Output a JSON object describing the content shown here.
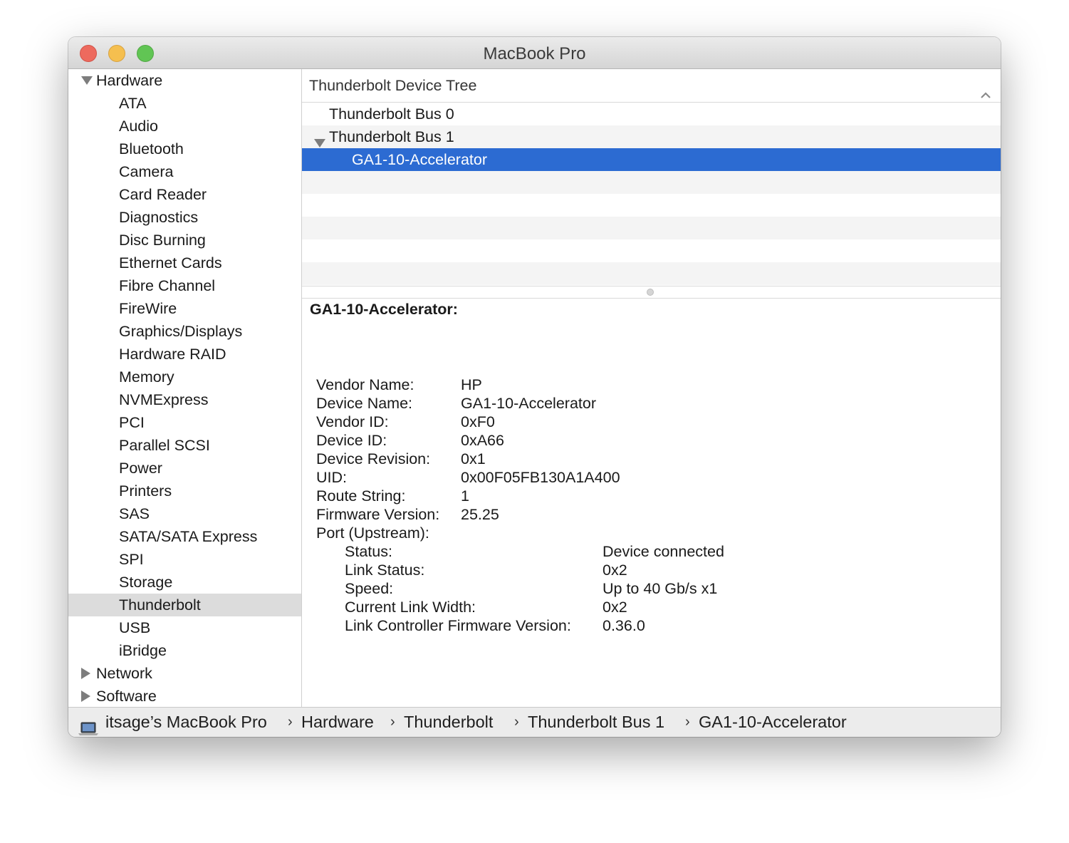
{
  "window": {
    "title": "MacBook Pro",
    "controls": {
      "close": "close",
      "minimize": "minimize",
      "zoom": "zoom"
    }
  },
  "sidebar": {
    "groups": [
      {
        "label": "Hardware",
        "expanded": true,
        "children": [
          "ATA",
          "Audio",
          "Bluetooth",
          "Camera",
          "Card Reader",
          "Diagnostics",
          "Disc Burning",
          "Ethernet Cards",
          "Fibre Channel",
          "FireWire",
          "Graphics/Displays",
          "Hardware RAID",
          "Memory",
          "NVMExpress",
          "PCI",
          "Parallel SCSI",
          "Power",
          "Printers",
          "SAS",
          "SATA/SATA Express",
          "SPI",
          "Storage",
          "Thunderbolt",
          "USB",
          "iBridge"
        ]
      },
      {
        "label": "Network",
        "expanded": false
      },
      {
        "label": "Software",
        "expanded": false
      }
    ],
    "selected": "Thunderbolt"
  },
  "tree": {
    "header": "Thunderbolt Device Tree",
    "sort_icon": "chevron-up-icon",
    "rows": [
      {
        "label": "Thunderbolt Bus 0",
        "level": 0,
        "expandable": false
      },
      {
        "label": "Thunderbolt Bus 1",
        "level": 0,
        "expandable": true,
        "expanded": true
      },
      {
        "label": "GA1-10-Accelerator",
        "level": 1,
        "selected": true
      }
    ]
  },
  "detail": {
    "title": "GA1-10-Accelerator:",
    "fields": [
      {
        "key": "Vendor Name:",
        "value": "HP"
      },
      {
        "key": "Device Name:",
        "value": "GA1-10-Accelerator"
      },
      {
        "key": "Vendor ID:",
        "value": "0xF0"
      },
      {
        "key": "Device ID:",
        "value": "0xA66"
      },
      {
        "key": "Device Revision:",
        "value": "0x1"
      },
      {
        "key": "UID:",
        "value": "0x00F05FB130A1A400"
      },
      {
        "key": "Route String:",
        "value": "1"
      },
      {
        "key": "Firmware Version:",
        "value": "25.25"
      },
      {
        "key": "Port (Upstream):",
        "value": ""
      }
    ],
    "port_fields": [
      {
        "key": "Status:",
        "value": "Device connected"
      },
      {
        "key": "Link Status:",
        "value": "0x2"
      },
      {
        "key": "Speed:",
        "value": "Up to 40 Gb/s x1"
      },
      {
        "key": "Current Link Width:",
        "value": "0x2"
      },
      {
        "key": "Link Controller Firmware Version:",
        "value": "0.36.0"
      }
    ]
  },
  "statusbar": {
    "icon": "laptop-icon",
    "separator": "›",
    "path": [
      "itsage’s MacBook Pro",
      "Hardware",
      "Thunderbolt",
      "Thunderbolt Bus 1",
      "GA1-10-Accelerator"
    ]
  },
  "colors": {
    "selection": "#2c6bd2",
    "sidebar_selection": "#dcdcdc",
    "close": "#ed6a5e",
    "minimize": "#f5bf4f",
    "zoom": "#61c554"
  }
}
